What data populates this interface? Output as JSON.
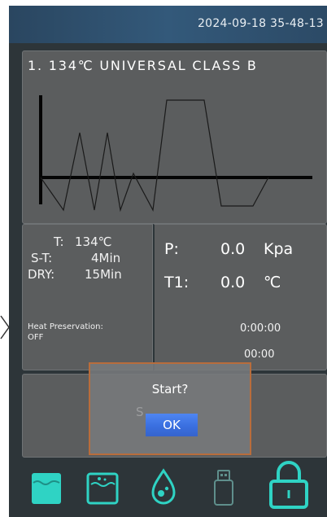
{
  "header": {
    "datetime": "2024-09-18  35-48-13"
  },
  "program": {
    "title": "1. 134℃ UNIVERSAL CLASS B"
  },
  "params": {
    "temp_label": "T:",
    "temp_value": "134℃",
    "st_label": "S-T:",
    "st_value": "4Min",
    "dry_label": "DRY:",
    "dry_value": "15Min",
    "heat_label": "Heat Preservation:",
    "heat_value": "OFF"
  },
  "readings": {
    "pressure_label": "P:",
    "pressure_value": "0.0",
    "pressure_unit": "Kpa",
    "t1_label": "T1:",
    "t1_value": "0.0",
    "t1_unit": "℃",
    "elapsed_time": "0:00:00",
    "remaining_time": "00:00"
  },
  "dialog": {
    "message": "Start?",
    "ok_label": "OK",
    "background_text": "S"
  },
  "toolbar": {
    "icons": [
      "water-tank-full-icon",
      "water-tank-empty-icon",
      "water-drop-icon",
      "usb-drive-icon",
      "padlock-icon"
    ],
    "icon_color": "#2fd3c4"
  },
  "colors": {
    "panel": "#5b5d5e",
    "background": "#2d3539",
    "header": "#33597a",
    "dialog_border": "#b86d3c",
    "ok_button": "#4f86f2"
  }
}
